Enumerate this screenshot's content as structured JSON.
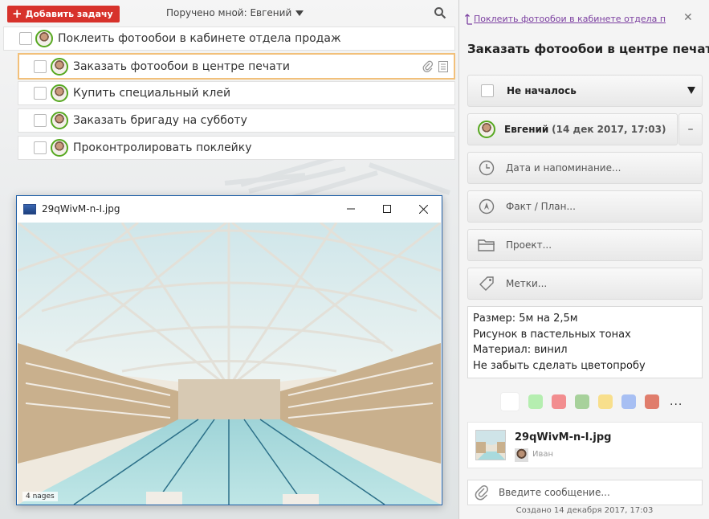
{
  "toolbar": {
    "add_task_label": "Добавить задачу",
    "filter_label": "Поручено мной: Евгений"
  },
  "tasks": [
    {
      "title": "Поклеить фотообои в кабинете отдела продаж",
      "level": 0
    },
    {
      "title": "Заказать фотообои в центре печати",
      "level": 1,
      "selected": true
    },
    {
      "title": "Купить специальный клей",
      "level": 1
    },
    {
      "title": "Заказать бригаду на субботу",
      "level": 1
    },
    {
      "title": "Проконтролировать поклейку",
      "level": 1
    }
  ],
  "viewer": {
    "title": "29qWivM-n-I.jpg",
    "photo_caption": "4 nages"
  },
  "details": {
    "parent_link": "Поклеить фотообои в кабинете отдела про...",
    "title": "Заказать фотообои в центре печати",
    "status": "Не началось",
    "assignee_name": "Евгений",
    "assignee_date": "(14 дек 2017, 17:03)",
    "remove_assignee": "–",
    "date_reminder": "Дата и напоминание...",
    "fact_plan": "Факт / План...",
    "project": "Проект...",
    "tags": "Метки...",
    "notes": [
      "Размер: 5м на 2,5м",
      "Рисунок в пастельных тонах",
      "Материал: винил",
      "Не забыть сделать цветопробу"
    ],
    "colors": [
      "#ffffff",
      "#b5eeb0",
      "#f28d8f",
      "#a7d19b",
      "#f8df8c",
      "#a7bff3",
      "#e07d6c"
    ],
    "more_colors": "...",
    "attachment": {
      "file_name": "29qWivM-n-I.jpg",
      "uploader": "Иван"
    },
    "message_placeholder": "Введите сообщение...",
    "created": "Создано 14 декабря 2017, 17:03"
  }
}
